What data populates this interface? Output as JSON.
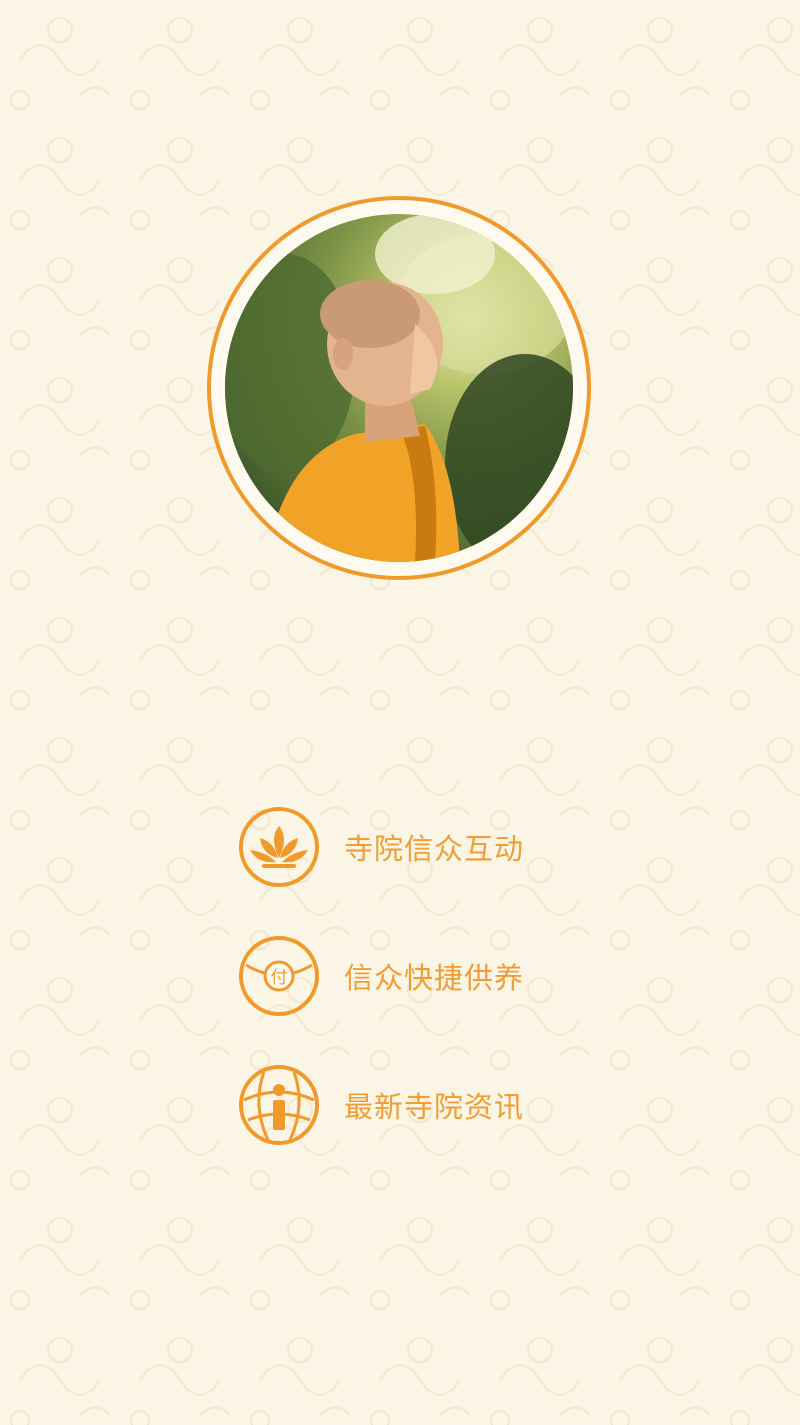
{
  "theme": {
    "accent": "#f19a2c",
    "label_color": "#ef9d34",
    "background": "#fbf5e6"
  },
  "avatar": {
    "icon": "monk-portrait",
    "ring_color": "#f19a2c"
  },
  "menu": {
    "items": [
      {
        "label": "寺院信众互动",
        "icon": "lotus-icon"
      },
      {
        "label": "信众快捷供养",
        "icon": "payment-icon",
        "icon_text": "付"
      },
      {
        "label": "最新寺院资讯",
        "icon": "info-globe-icon"
      }
    ]
  }
}
